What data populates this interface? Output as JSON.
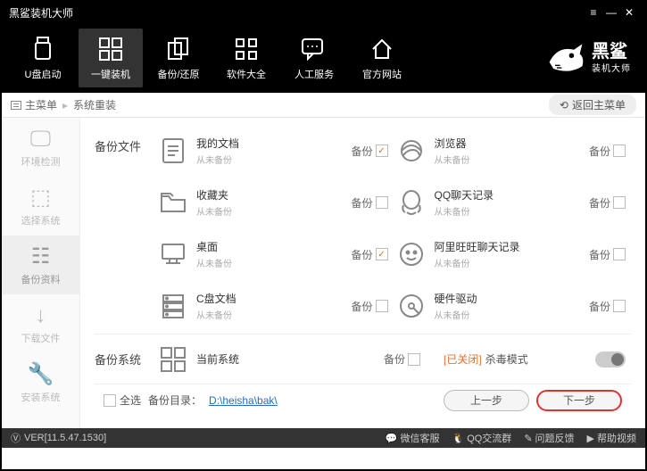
{
  "window": {
    "title": "黑鲨装机大师"
  },
  "nav": {
    "items": [
      {
        "label": "U盘启动"
      },
      {
        "label": "一键装机"
      },
      {
        "label": "备份/还原"
      },
      {
        "label": "软件大全"
      },
      {
        "label": "人工服务"
      },
      {
        "label": "官方网站"
      }
    ]
  },
  "brand": {
    "name": "黑鲨",
    "sub": "装机大师"
  },
  "crumb": {
    "root": "主菜单",
    "current": "系统重装",
    "back": "返回主菜单"
  },
  "sidebar": {
    "items": [
      {
        "label": "环境检测"
      },
      {
        "label": "选择系统"
      },
      {
        "label": "备份资料"
      },
      {
        "label": "下载文件"
      },
      {
        "label": "安装系统"
      }
    ]
  },
  "sections": {
    "files_label": "备份文件",
    "sys_label": "备份系统",
    "backup_word": "备份",
    "never": "从未备份",
    "items": [
      {
        "title": "我的文档",
        "checked": true,
        "icon": "doc"
      },
      {
        "title": "浏览器",
        "checked": false,
        "icon": "ie"
      },
      {
        "title": "收藏夹",
        "checked": false,
        "icon": "folder"
      },
      {
        "title": "QQ聊天记录",
        "checked": false,
        "icon": "qq"
      },
      {
        "title": "桌面",
        "checked": true,
        "icon": "desktop"
      },
      {
        "title": "阿里旺旺聊天记录",
        "checked": false,
        "icon": "ww"
      },
      {
        "title": "C盘文档",
        "checked": false,
        "icon": "server"
      },
      {
        "title": "硬件驱动",
        "checked": false,
        "icon": "hdd"
      }
    ],
    "sys_item": {
      "title": "当前系统"
    },
    "kill": {
      "off": "[已关闭]",
      "label": "杀毒模式"
    }
  },
  "bottom": {
    "all": "全选",
    "dir_label": "备份目录：",
    "dir": "D:\\heisha\\bak\\",
    "prev": "上一步",
    "next": "下一步"
  },
  "status": {
    "ver": "VER[11.5.47.1530]",
    "links": [
      "微信客服",
      "QQ交流群",
      "问题反馈",
      "帮助视频"
    ]
  }
}
